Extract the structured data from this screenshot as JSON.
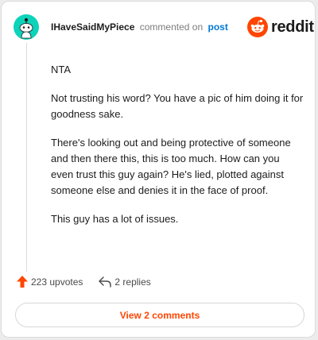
{
  "comment": {
    "username": "IHaveSaidMyPiece",
    "action_text": "commented on",
    "post_link": "post",
    "paragraphs": [
      "NTA",
      "Not trusting his word? You have a pic of him doing it for goodness sake.",
      "There's looking out and being protective of someone and then there this, this is too much. How can you even trust this guy again? He's lied, plotted against someone else and denies it in the face of proof.",
      "This guy has a lot of issues."
    ]
  },
  "brand": {
    "name": "reddit",
    "icon": "reddit-alien-icon",
    "color": "#ff4500"
  },
  "footer": {
    "upvotes_label": "223 upvotes",
    "replies_label": "2 replies",
    "upvote_icon": "upvote-arrow-icon",
    "reply_icon": "reply-arrow-icon"
  },
  "view_comments_label": "View 2 comments",
  "colors": {
    "accent": "#ff4500",
    "link": "#0079d3",
    "avatar": "#0dd3bb"
  }
}
